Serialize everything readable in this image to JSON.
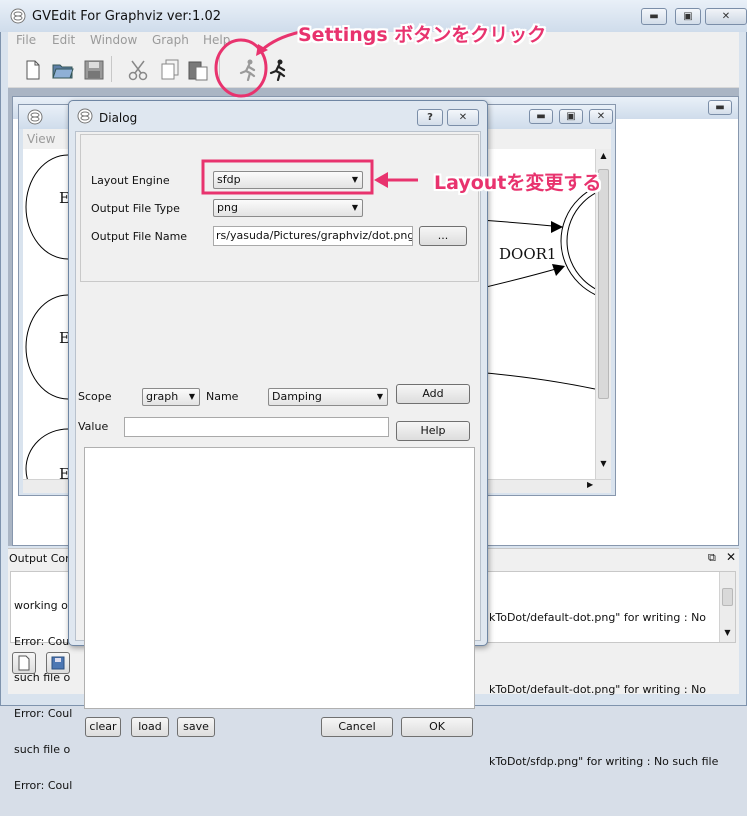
{
  "app": {
    "title": "GVEdit For Graphviz ver:1.02",
    "menu": [
      "File",
      "Edit",
      "Window",
      "Graph",
      "Help"
    ]
  },
  "subwindow": {
    "menu_view": "View",
    "node_labels": [
      "E",
      "E",
      "E"
    ],
    "node_door": "DOOR1"
  },
  "dialog": {
    "title": "Dialog",
    "help_glyph": "?",
    "layout_engine_label": "Layout Engine",
    "layout_engine_value": "sfdp",
    "output_type_label": "Output File Type",
    "output_type_value": "png",
    "output_name_label": "Output File Name",
    "output_name_value": "rs/yasuda/Pictures/graphviz/dot.png",
    "browse_label": "...",
    "scope_label": "Scope",
    "scope_value": "graph",
    "name_label": "Name",
    "name_value": "Damping",
    "add_label": "Add",
    "value_label": "Value",
    "value_value": "",
    "help_label": "Help",
    "clear_label": "clear",
    "load_label": "load",
    "save_label": "save",
    "cancel_label": "Cancel",
    "ok_label": "OK"
  },
  "output": {
    "title": "Output Con",
    "left_lines": [
      "working on",
      "Error: Coul",
      "such file o",
      "Error: Coul",
      "such file o",
      "Error: Coul"
    ],
    "right_lines": [
      "kToDot/default-dot.png\" for writing : No",
      "kToDot/default-dot.png\" for writing : No",
      "kToDot/sfdp.png\" for writing : No such file"
    ]
  },
  "annotations": {
    "settings": "Settings ボタンをクリック",
    "layout": "Layoutを変更する",
    "color": "#e8336e"
  }
}
